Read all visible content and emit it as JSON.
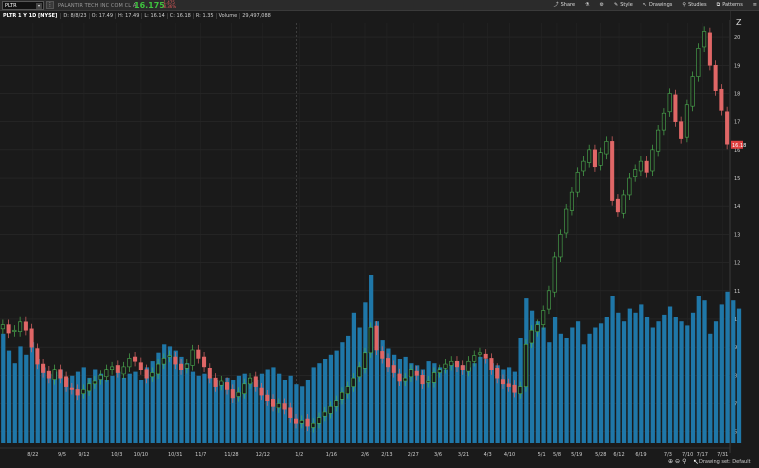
{
  "toolbar": {
    "symbol_input": "PLTR",
    "company": "PALANTIR TECH INC COM CL A",
    "price": "16.175",
    "change1": "-1.475",
    "change2": "-8.36%",
    "tools": {
      "share": "Share",
      "style": "Style",
      "drawings": "Drawings",
      "studies": "Studies",
      "patterns": "Patterns"
    }
  },
  "info": {
    "title": "PLTR 1 Y 1D [NYSE]",
    "items": [
      "D: 8/8/23",
      "O: 17.49",
      "H: 17.49",
      "L: 16.14",
      "C: 16.18",
      "R: 1.35",
      "Volume",
      "29,497,088"
    ]
  },
  "footer": {
    "drawing_set": "Drawing set: Default"
  },
  "colors": {
    "up": "#2e8b2e",
    "down": "#e06767",
    "volume": "#1f77a8",
    "last_price_bg": "#e04040"
  },
  "chart_data": {
    "type": "candlestick",
    "title": "",
    "price_axis_ticks": [
      6,
      7,
      8,
      9,
      10,
      11,
      12,
      13,
      14,
      15,
      16,
      17,
      18,
      19,
      20
    ],
    "last_price_label": "16.18",
    "ylim": [
      5.6,
      20.5
    ],
    "x_ticks": [
      "8/22",
      "9/5",
      "9/12",
      "10/3",
      "10/10",
      "10/31",
      "11/7",
      "11/28",
      "12/12",
      "1/2",
      "1/16",
      "2/6",
      "2/13",
      "2/27",
      "3/6",
      "3/21",
      "4/3",
      "4/10",
      "5/1",
      "5/8",
      "5/19",
      "5/28",
      "6/12",
      "6/19",
      "7/3",
      "7/10",
      "7/17",
      "7/31"
    ],
    "x_tick_positions": [
      0.045,
      0.085,
      0.115,
      0.16,
      0.193,
      0.24,
      0.275,
      0.317,
      0.36,
      0.41,
      0.454,
      0.5,
      0.53,
      0.566,
      0.6,
      0.635,
      0.668,
      0.698,
      0.742,
      0.763,
      0.79,
      0.823,
      0.848,
      0.878,
      0.915,
      0.942,
      0.962,
      0.99
    ],
    "close": [
      9.8,
      9.5,
      9.6,
      9.9,
      9.6,
      9.0,
      8.4,
      8.1,
      7.9,
      8.2,
      7.9,
      7.6,
      7.5,
      7.3,
      7.5,
      7.7,
      7.8,
      8.0,
      8.2,
      8.3,
      8.1,
      8.3,
      8.6,
      8.5,
      8.2,
      7.9,
      8.1,
      8.4,
      8.6,
      8.7,
      8.4,
      8.2,
      8.4,
      8.9,
      8.6,
      8.3,
      7.9,
      7.6,
      7.8,
      7.5,
      7.2,
      7.4,
      7.7,
      7.9,
      7.6,
      7.3,
      7.1,
      6.9,
      7.0,
      6.8,
      6.5,
      6.3,
      6.4,
      6.2,
      6.3,
      6.5,
      6.7,
      6.9,
      7.1,
      7.4,
      7.6,
      7.9,
      8.3,
      8.8,
      9.7,
      8.9,
      8.6,
      8.3,
      8.1,
      7.8,
      7.9,
      8.2,
      8.0,
      7.7,
      7.8,
      8.1,
      8.2,
      8.4,
      8.5,
      8.3,
      8.2,
      8.5,
      8.7,
      8.8,
      8.6,
      8.2,
      7.9,
      7.7,
      7.6,
      7.4,
      7.6,
      9.1,
      9.6,
      9.8,
      10.3,
      11.0,
      12.2,
      13.0,
      13.9,
      14.5,
      15.2,
      15.6,
      16.0,
      15.4,
      15.9,
      16.3,
      14.2,
      13.8,
      14.4,
      15.0,
      15.3,
      15.6,
      15.2,
      16.0,
      16.7,
      17.3,
      18.0,
      17.0,
      16.4,
      17.6,
      18.6,
      19.6,
      20.2,
      19.0,
      18.1,
      17.4,
      16.2
    ],
    "volume": [
      52,
      44,
      38,
      46,
      42,
      48,
      40,
      36,
      33,
      34,
      35,
      31,
      32,
      34,
      36,
      31,
      35,
      33,
      30,
      32,
      34,
      31,
      33,
      34,
      30,
      36,
      39,
      43,
      47,
      46,
      44,
      41,
      38,
      34,
      32,
      33,
      31,
      30,
      29,
      31,
      30,
      32,
      33,
      29,
      30,
      33,
      35,
      36,
      33,
      30,
      32,
      28,
      27,
      30,
      36,
      38,
      40,
      42,
      44,
      48,
      51,
      62,
      55,
      67,
      80,
      58,
      49,
      45,
      42,
      40,
      41,
      38,
      37,
      35,
      39,
      38,
      36,
      35,
      38,
      39,
      37,
      36,
      38,
      41,
      40,
      38,
      37,
      35,
      36,
      34,
      50,
      69,
      63,
      58,
      55,
      48,
      60,
      52,
      50,
      55,
      58,
      47,
      52,
      55,
      57,
      60,
      70,
      62,
      58,
      64,
      62,
      66,
      60,
      55,
      58,
      61,
      65,
      60,
      58,
      56,
      62,
      70,
      68,
      52,
      58,
      66,
      72,
      68,
      64
    ]
  }
}
